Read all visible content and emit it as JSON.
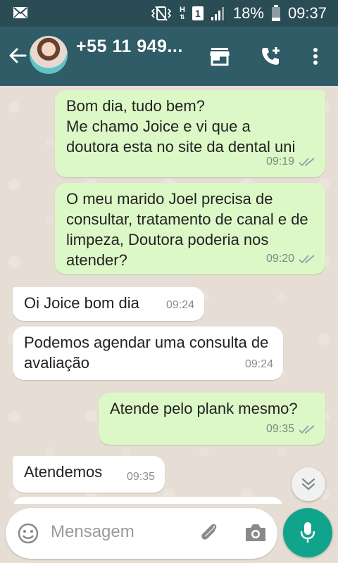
{
  "status_bar": {
    "battery": "18%",
    "time": "09:37",
    "network_letter": "H",
    "sim_slot": "1"
  },
  "header": {
    "contact": "+55 11 949...",
    "icons": [
      "back-arrow-icon",
      "store-icon",
      "add-call-icon",
      "more-vert-icon"
    ]
  },
  "messages": [
    {
      "direction": "outgoing",
      "text": "Bom dia, tudo bem?\nMe chamo Joice e vi que a doutora esta no site da dental uni",
      "time": "09:19",
      "status": "read"
    },
    {
      "direction": "outgoing",
      "text": "O meu marido Joel precisa de consultar, tratamento de canal  e de limpeza, Doutora poderia nos atender?",
      "time": "09:20",
      "status": "read"
    },
    {
      "direction": "incoming",
      "text": "Oi Joice bom dia",
      "time": "09:24"
    },
    {
      "direction": "incoming",
      "text": "Podemos agendar uma consulta de avaliação",
      "time": "09:24"
    },
    {
      "direction": "outgoing",
      "text": "Atende pelo plank mesmo?",
      "time": "09:35",
      "status": "read"
    },
    {
      "direction": "incoming",
      "text": "Atendemos",
      "time": "09:35"
    }
  ],
  "composer": {
    "placeholder": "Mensagem"
  },
  "colors": {
    "header": "#2f5c66",
    "status_bar": "#2a4c55",
    "outgoing_bubble": "#dcf8c6",
    "incoming_bubble": "#ffffff",
    "mic_button": "#11a48c",
    "read_ticks": "#8aa1b1"
  }
}
